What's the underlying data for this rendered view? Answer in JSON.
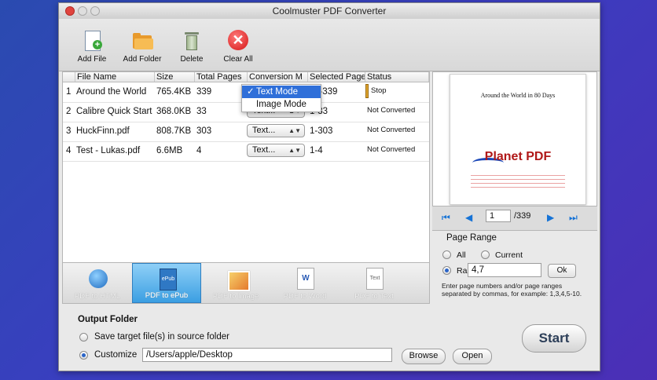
{
  "window": {
    "title": "Coolmuster PDF Converter"
  },
  "toolbar": {
    "add_file": "Add File",
    "add_folder": "Add Folder",
    "delete": "Delete",
    "clear_all": "Clear All"
  },
  "table": {
    "headers": [
      "File Name",
      "Size",
      "Total Pages",
      "Conversion M",
      "Selected Page",
      "Status"
    ],
    "rows": [
      {
        "index": "1",
        "name": "Around the World",
        "size": "765.4KB",
        "pages": "339",
        "mode": "Text...",
        "selected": "1-339",
        "status": "Stop"
      },
      {
        "index": "2",
        "name": "Calibre Quick Start",
        "size": "368.0KB",
        "pages": "33",
        "mode": "Text...",
        "selected": "1-33",
        "status": "Not Converted"
      },
      {
        "index": "3",
        "name": "HuckFinn.pdf",
        "size": "808.7KB",
        "pages": "303",
        "mode": "Text...",
        "selected": "1-303",
        "status": "Not Converted"
      },
      {
        "index": "4",
        "name": "Test - Lukas.pdf",
        "size": "6.6MB",
        "pages": "4",
        "mode": "Text...",
        "selected": "1-4",
        "status": "Not Converted"
      }
    ],
    "dropdown": {
      "check": "✓",
      "options": [
        "Text Mode",
        "Image Mode"
      ],
      "selected": "Text Mode"
    }
  },
  "preview": {
    "doc_title": "Around the World in 80 Days",
    "logo_text": "Planet PDF",
    "current_page": "1",
    "total": "/339"
  },
  "page_range": {
    "title": "Page Range",
    "all": "All",
    "current": "Current",
    "range": "Range",
    "range_value": "4,7",
    "ok": "Ok",
    "hint": "Enter page numbers and/or page ranges separated by commas, for example: 1,3,4,5-10."
  },
  "formats": [
    {
      "label": "PDF to HTML",
      "icon_text": ""
    },
    {
      "label": "PDF to ePub",
      "icon_text": "ePub"
    },
    {
      "label": "PDF to Image",
      "icon_text": ""
    },
    {
      "label": "PDF to Word",
      "icon_text": "W"
    },
    {
      "label": "PDF to Text",
      "icon_text": "Text"
    }
  ],
  "output": {
    "title": "Output Folder",
    "save_source": "Save target file(s) in source folder",
    "customize": "Customize",
    "path": "/Users/apple/Desktop",
    "browse": "Browse",
    "open": "Open",
    "start": "Start"
  },
  "colors": {
    "accent": "#2f6fd9",
    "active_format": "#3b9fe2",
    "progress": "#e0a630",
    "pager_icon": "#1673d6"
  }
}
